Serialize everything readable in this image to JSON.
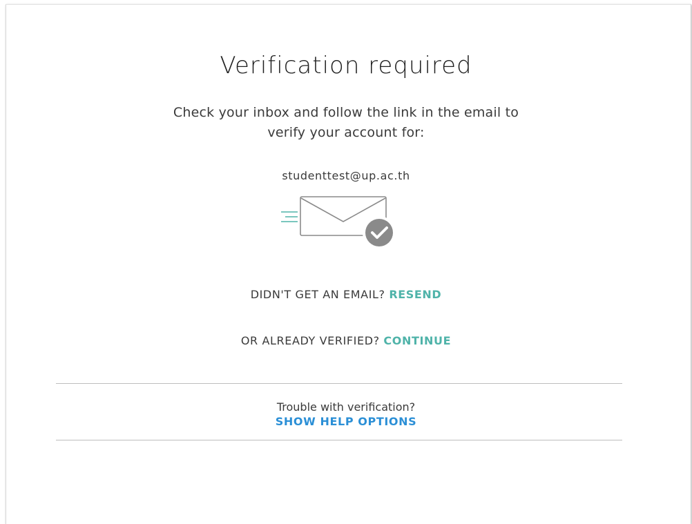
{
  "verification": {
    "title": "Verification required",
    "instructions_line1": "Check your inbox and follow the link in the email to",
    "instructions_line2": "verify your account for:",
    "email": "studenttest@up.ac.th",
    "mail_icon": "envelope-check-icon"
  },
  "resend": {
    "prompt": "DIDN'T GET AN EMAIL?",
    "link": "RESEND"
  },
  "continue": {
    "prompt": "OR ALREADY VERIFIED?",
    "link": "CONTINUE"
  },
  "help": {
    "question": "Trouble with verification?",
    "link": "SHOW HELP OPTIONS"
  },
  "colors": {
    "accent_teal": "#4fb3a9",
    "link_blue": "#2b8fd6",
    "check_badge": "#8a8a8a"
  }
}
